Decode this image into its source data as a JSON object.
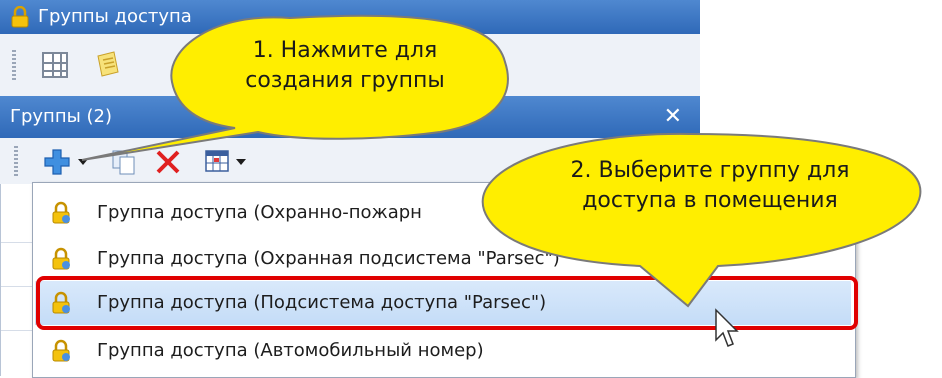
{
  "window": {
    "title": "Группы доступа"
  },
  "panel": {
    "title": "Группы (2)",
    "close": "✕"
  },
  "dropdown": {
    "items": [
      {
        "label": "Группа доступа (Охранно-пожарн"
      },
      {
        "label": "Группа доступа (Охранная подсистема \"Parsec\")"
      },
      {
        "label": "Группа доступа (Подсистема доступа \"Parsec\")"
      },
      {
        "label": "Группа доступа (Автомобильный номер)"
      }
    ]
  },
  "callouts": {
    "first": {
      "line1": "1. Нажмите для",
      "line2": "создания группы"
    },
    "second": {
      "line1": "2. Выберите группу для",
      "line2": "доступа в помещения"
    }
  },
  "colors": {
    "accent": "#3776c5",
    "highlight": "#e00000",
    "callout": "#ffee00"
  }
}
